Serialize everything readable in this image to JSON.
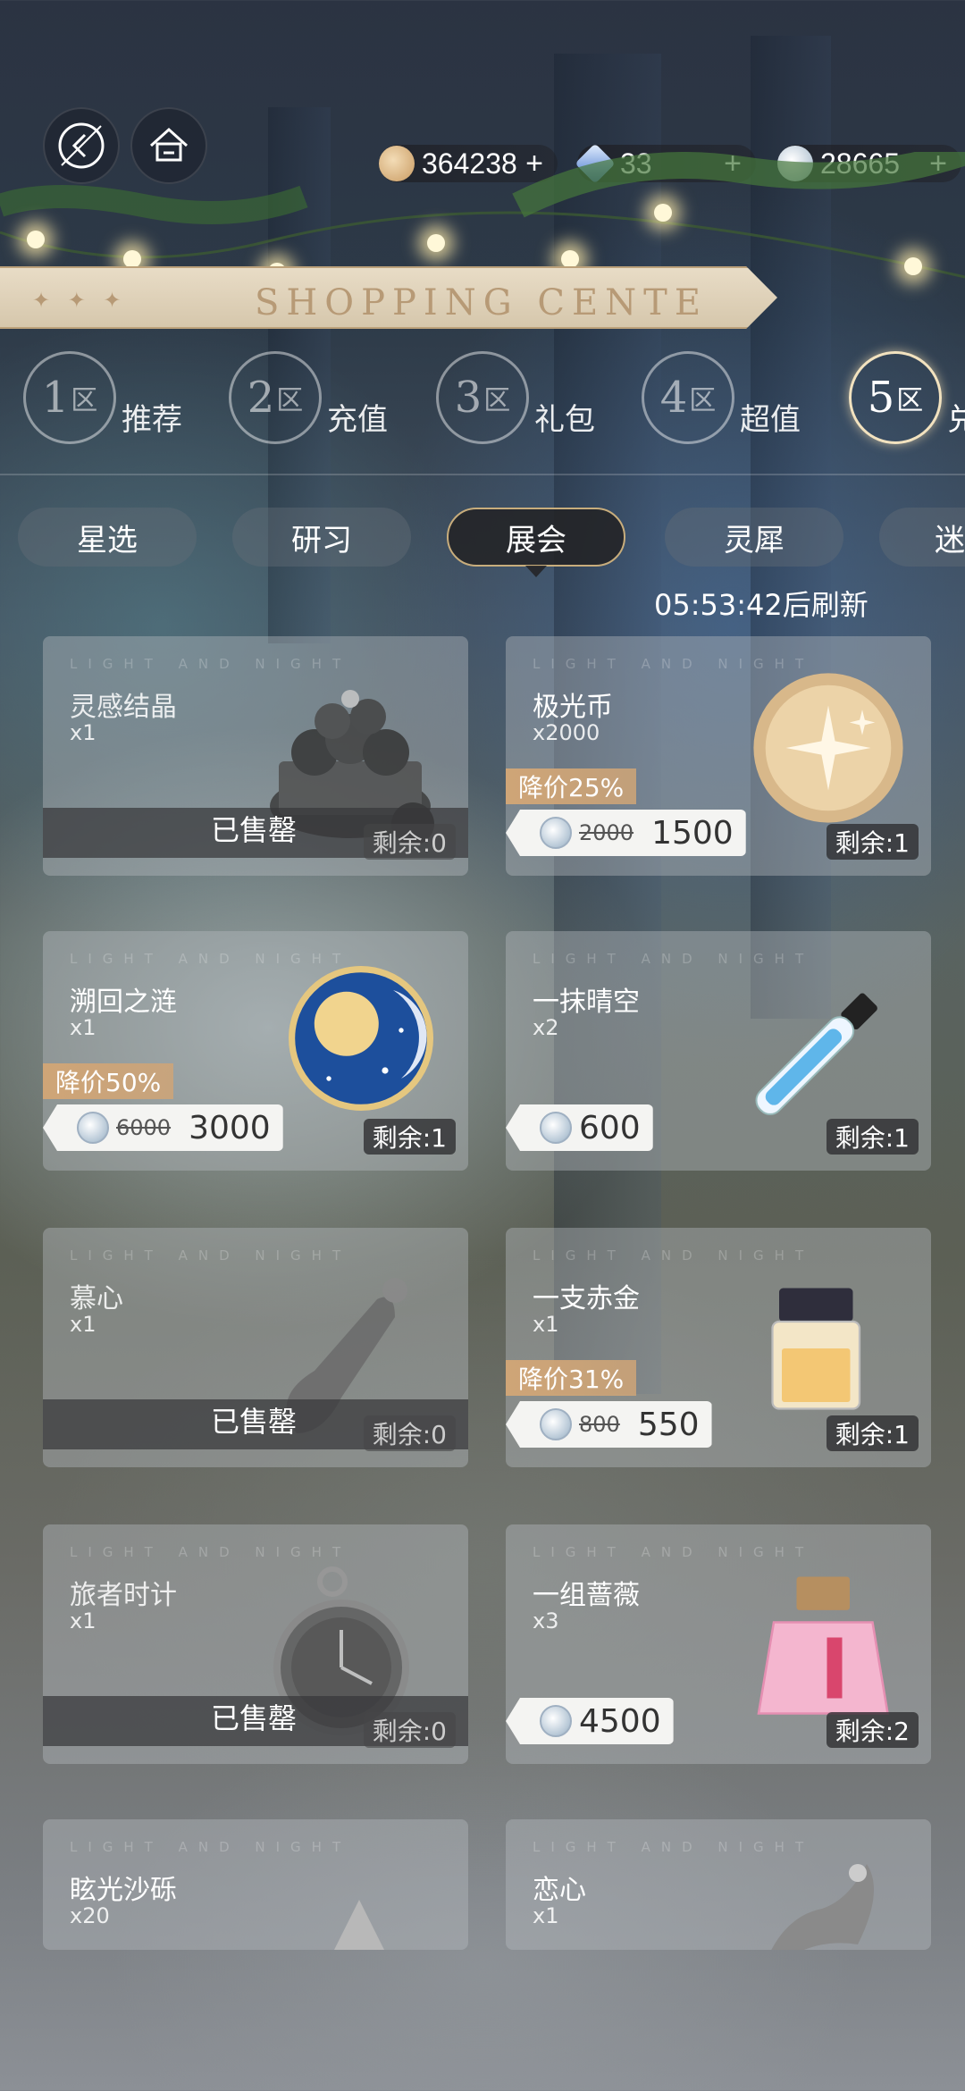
{
  "nav": {
    "back_icon": "back-icon",
    "home_icon": "home-icon"
  },
  "currencies": [
    {
      "icon": "gold-coin-icon",
      "amount": "364238",
      "plus": "+",
      "color": "#d9b27c"
    },
    {
      "icon": "diamond-icon",
      "amount": "33",
      "plus": "+",
      "color": "#8fb2e8"
    },
    {
      "icon": "silver-coin-icon",
      "amount": "28665",
      "plus": "+",
      "color": "#cfd8e0"
    }
  ],
  "banner": {
    "title": "SHOPPING CENTE",
    "stars": "✦ ✦ ✦"
  },
  "zones": [
    {
      "num": "1",
      "qu": "区",
      "label": "推荐"
    },
    {
      "num": "2",
      "qu": "区",
      "label": "充值"
    },
    {
      "num": "3",
      "qu": "区",
      "label": "礼包"
    },
    {
      "num": "4",
      "qu": "区",
      "label": "超值"
    },
    {
      "num": "5",
      "qu": "区",
      "label": "兑"
    }
  ],
  "active_zone": "5",
  "subtabs": [
    "星选",
    "研习",
    "展会",
    "灵犀",
    "迷"
  ],
  "active_subtab": "展会",
  "refresh_text": "05:53:42后刷新",
  "watermark": "LIGHT AND NIGHT",
  "sold_label": "已售罄",
  "items": [
    {
      "name": "灵感结晶",
      "qty": "x1",
      "remain": "剩余:0",
      "sold": true
    },
    {
      "name": "极光币",
      "qty": "x2000",
      "remain": "剩余:1",
      "discount": "降价25%",
      "old_price": "2000",
      "price": "1500"
    },
    {
      "name": "溯回之涟",
      "qty": "x1",
      "remain": "剩余:1",
      "discount": "降价50%",
      "old_price": "6000",
      "price": "3000"
    },
    {
      "name": "一抹晴空",
      "qty": "x2",
      "remain": "剩余:1",
      "price": "600"
    },
    {
      "name": "慕心",
      "qty": "x1",
      "remain": "剩余:0",
      "sold": true
    },
    {
      "name": "一支赤金",
      "qty": "x1",
      "remain": "剩余:1",
      "discount": "降价31%",
      "old_price": "800",
      "price": "550"
    },
    {
      "name": "旅者时计",
      "qty": "x1",
      "remain": "剩余:0",
      "sold": true
    },
    {
      "name": "一组蔷薇",
      "qty": "x3",
      "remain": "剩余:2",
      "price": "4500"
    },
    {
      "name": "眩光沙砾",
      "qty": "x20"
    },
    {
      "name": "恋心",
      "qty": "x1"
    }
  ],
  "colors": {
    "accent": "#c8ad7c",
    "discount": "#cfa577",
    "banner": "#e2d5bd"
  }
}
